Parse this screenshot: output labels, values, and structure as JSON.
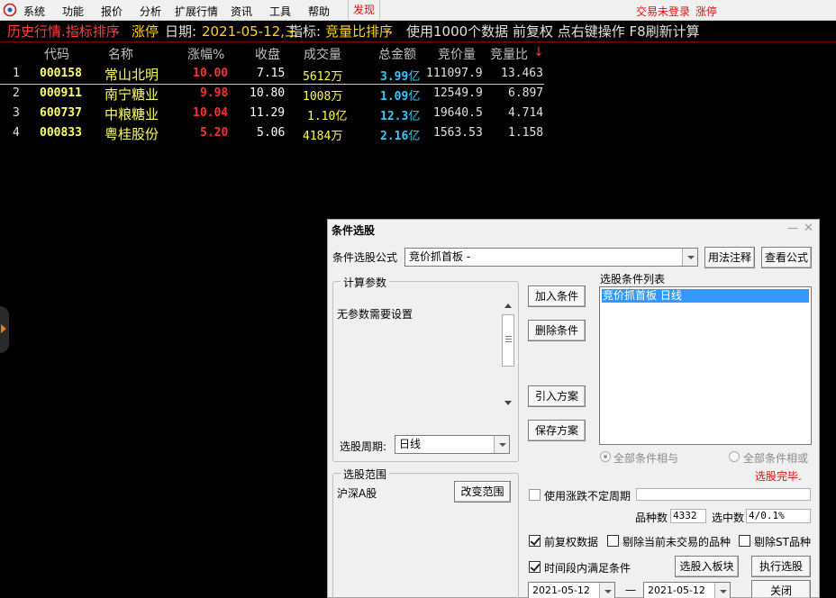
{
  "menubar": {
    "items": [
      "系统",
      "功能",
      "报价",
      "分析",
      "扩展行情",
      "资讯",
      "工具",
      "帮助"
    ],
    "highlight": "发现",
    "login_status": "交易未登录",
    "status_tag": "涨停"
  },
  "titlebar": {
    "section": "历史行情.指标排序",
    "filter": "涨停",
    "date_label": "日期:",
    "date_value": "2021-05-12,三",
    "indicator_label": "指标:",
    "indicator_value": "竞量比排序",
    "info": "使用1000个数据 前复权 点右键操作 F8刷新计算"
  },
  "table": {
    "headers": {
      "code": "代码",
      "name": "名称",
      "pct": "涨幅%",
      "close": "收盘",
      "volume": "成交量",
      "amount": "总金额",
      "bid_price": "竞价量",
      "ratio": "竞量比"
    },
    "sort_arrow": "↓",
    "rows": [
      {
        "idx": "1",
        "code": "000158",
        "name": "常山北明",
        "pct": "10.00",
        "close": "7.15",
        "vol": "5612",
        "vol_unit": "万",
        "amt": "3.99",
        "amt_unit": "亿",
        "bid": "111097.9",
        "ratio": "13.463"
      },
      {
        "idx": "2",
        "code": "000911",
        "name": "南宁糖业",
        "pct": "9.98",
        "close": "10.80",
        "vol": "1008",
        "vol_unit": "万",
        "amt": "1.09",
        "amt_unit": "亿",
        "bid": "12549.9",
        "ratio": "6.897"
      },
      {
        "idx": "3",
        "code": "600737",
        "name": "中粮糖业",
        "pct": "10.04",
        "close": "11.29",
        "vol": "1.10",
        "vol_unit": "亿",
        "amt": "12.3",
        "amt_unit": "亿",
        "bid": "19640.5",
        "ratio": "4.714"
      },
      {
        "idx": "4",
        "code": "000833",
        "name": "粤桂股份",
        "pct": "5.20",
        "close": "5.06",
        "vol": "4184",
        "vol_unit": "万",
        "amt": "2.16",
        "amt_unit": "亿",
        "bid": "1563.53",
        "ratio": "1.158"
      }
    ]
  },
  "dialog": {
    "title": "条件选股",
    "min_glyph": "—",
    "close_glyph": "✕",
    "formula_label": "条件选股公式",
    "formula_value": "竞价抓首板   -",
    "btn_usage": "用法注释",
    "btn_view": "查看公式",
    "params_group": "计算参数",
    "params_text": "无参数需要设置",
    "period_label": "选股周期:",
    "period_value": "日线",
    "btn_add": "加入条件",
    "btn_delete": "删除条件",
    "btn_import": "引入方案",
    "btn_save": "保存方案",
    "conditions_label": "选股条件列表",
    "conditions": [
      "竞价抓首板   日线"
    ],
    "radio_and": "全部条件相与",
    "radio_or": "全部条件相或",
    "status": "选股完毕.",
    "range_group": "选股范围",
    "range_value": "沪深A股",
    "btn_change_range": "改变范围",
    "chk_uncertain": "使用涨跌不定周期",
    "count_label": "品种数",
    "count_value": "4332",
    "selected_label": "选中数",
    "selected_value": "4/0.1%",
    "chk_adjust": "前复权数据",
    "chk_exclude_untraded": "剔除当前未交易的品种",
    "chk_exclude_st": "剔除ST品种",
    "chk_period": "时间段内满足条件",
    "btn_to_block": "选股入板块",
    "btn_execute": "执行选股",
    "date_from": "2021-05-12",
    "date_sep": "—",
    "date_to": "2021-05-12",
    "btn_close": "关闭",
    "colors": {
      "status": "#e01010",
      "selection": "#3399ff"
    }
  }
}
